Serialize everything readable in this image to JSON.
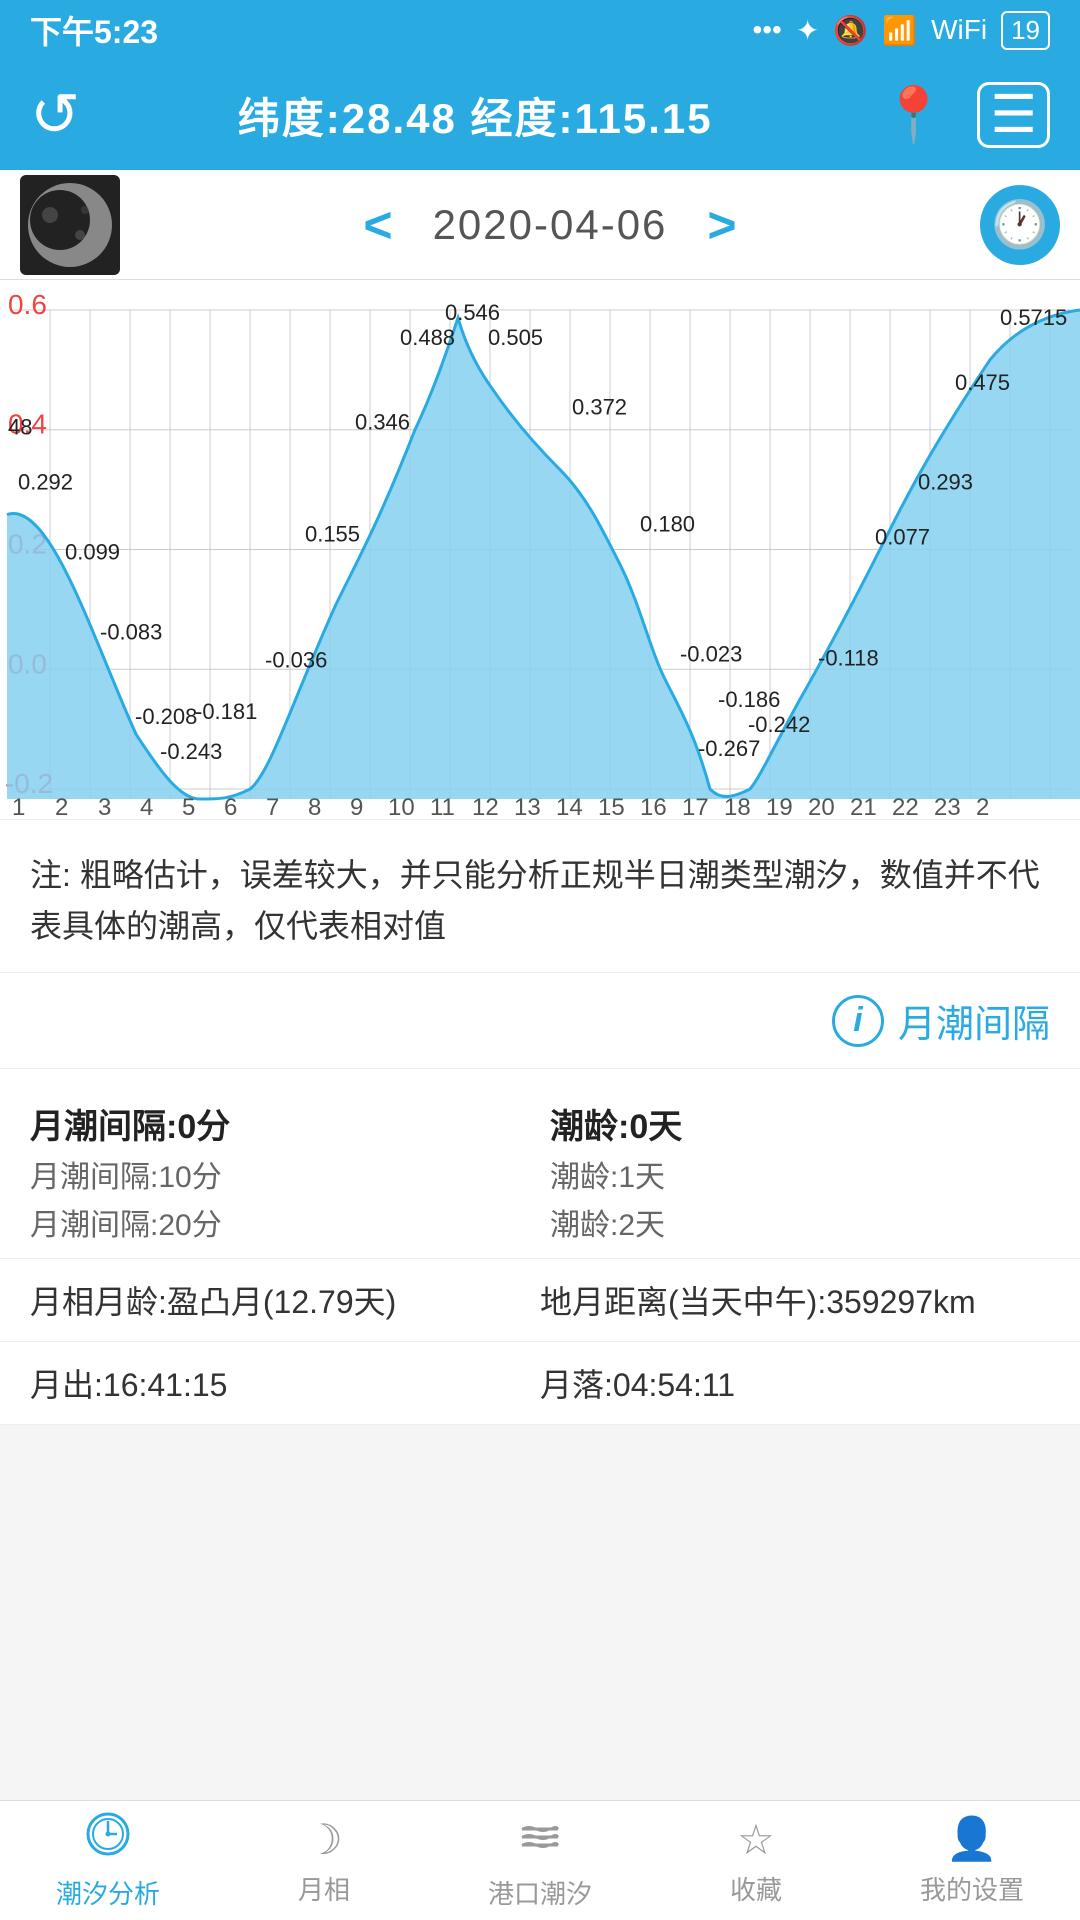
{
  "status": {
    "time": "下午5:23",
    "battery": "19"
  },
  "header": {
    "title": "纬度:28.48 经度:115.15",
    "refresh_label": "↺",
    "location_label": "📍",
    "menu_label": "☰"
  },
  "date_nav": {
    "date": "2020-04-06",
    "prev_label": "<",
    "next_label": ">"
  },
  "chart": {
    "y_labels": [
      "0.6",
      "0.4",
      "0.2",
      "0.0",
      "-0.2"
    ],
    "x_labels": [
      "1",
      "2",
      "3",
      "4",
      "5",
      "6",
      "7",
      "8",
      "9",
      "10",
      "11",
      "12",
      "13",
      "14",
      "15",
      "16",
      "17",
      "18",
      "19",
      "20",
      "21",
      "22",
      "23",
      "2"
    ],
    "data_points": [
      {
        "x": 1,
        "y": 0.292,
        "label": "0.292"
      },
      {
        "x": 2,
        "y": 0.099,
        "label": "0.099"
      },
      {
        "x": 3,
        "y": -0.083,
        "label": "-0.083"
      },
      {
        "x": 4,
        "y": -0.208,
        "label": "-0.208"
      },
      {
        "x": 4.5,
        "y": -0.243,
        "label": "-0.243"
      },
      {
        "x": 5,
        "y": -0.181,
        "label": "-0.181"
      },
      {
        "x": 7,
        "y": -0.036,
        "label": "-0.036"
      },
      {
        "x": 8,
        "y": 0.155,
        "label": "0.155"
      },
      {
        "x": 9,
        "y": 0.346,
        "label": "0.346"
      },
      {
        "x": 9.5,
        "y": 0.488,
        "label": "0.488"
      },
      {
        "x": 10,
        "y": 0.546,
        "label": "0.546"
      },
      {
        "x": 11,
        "y": 0.505,
        "label": "0.505"
      },
      {
        "x": 12,
        "y": 0.48,
        "label": "48"
      },
      {
        "x": 13,
        "y": 0.372,
        "label": "0.372"
      },
      {
        "x": 14.5,
        "y": 0.18,
        "label": "0.180"
      },
      {
        "x": 15.5,
        "y": -0.023,
        "label": "-0.023"
      },
      {
        "x": 16,
        "y": -0.186,
        "label": "-0.186"
      },
      {
        "x": 16.5,
        "y": -0.267,
        "label": "-0.267"
      },
      {
        "x": 17,
        "y": -0.242,
        "label": "-0.242"
      },
      {
        "x": 18.5,
        "y": -0.118,
        "label": "-0.118"
      },
      {
        "x": 20,
        "y": 0.077,
        "label": "0.077"
      },
      {
        "x": 21,
        "y": 0.293,
        "label": "0.293"
      },
      {
        "x": 22,
        "y": 0.475,
        "label": "0.475"
      },
      {
        "x": 23,
        "y": 0.571,
        "label": "0.571"
      }
    ]
  },
  "note": {
    "text": "注: 粗略估计，误差较大，并只能分析正规半日潮类型潮汐，数值并不代表具体的潮高，仅代表相对值"
  },
  "interval_section": {
    "info_icon": "i",
    "label": "月潮间隔"
  },
  "data_left": {
    "primary": "月潮间隔:0分",
    "secondary1": "月潮间隔:10分",
    "secondary2": "月潮间隔:20分"
  },
  "data_right": {
    "primary": "潮龄:0天",
    "secondary1": "潮龄:1天",
    "secondary2": "潮龄:2天"
  },
  "moon_info": {
    "phase": "月相月龄:盈凸月(12.79天)",
    "distance": "地月距离(当天中午):359297km",
    "rise": "月出:16:41:15",
    "set": "月落:04:54:11"
  },
  "bottom_nav": {
    "items": [
      {
        "id": "tidal",
        "label": "潮汐分析",
        "active": true
      },
      {
        "id": "moon",
        "label": "月相",
        "active": false
      },
      {
        "id": "harbor",
        "label": "港口潮汐",
        "active": false
      },
      {
        "id": "favorites",
        "label": "收藏",
        "active": false
      },
      {
        "id": "settings",
        "label": "我的设置",
        "active": false
      }
    ]
  }
}
